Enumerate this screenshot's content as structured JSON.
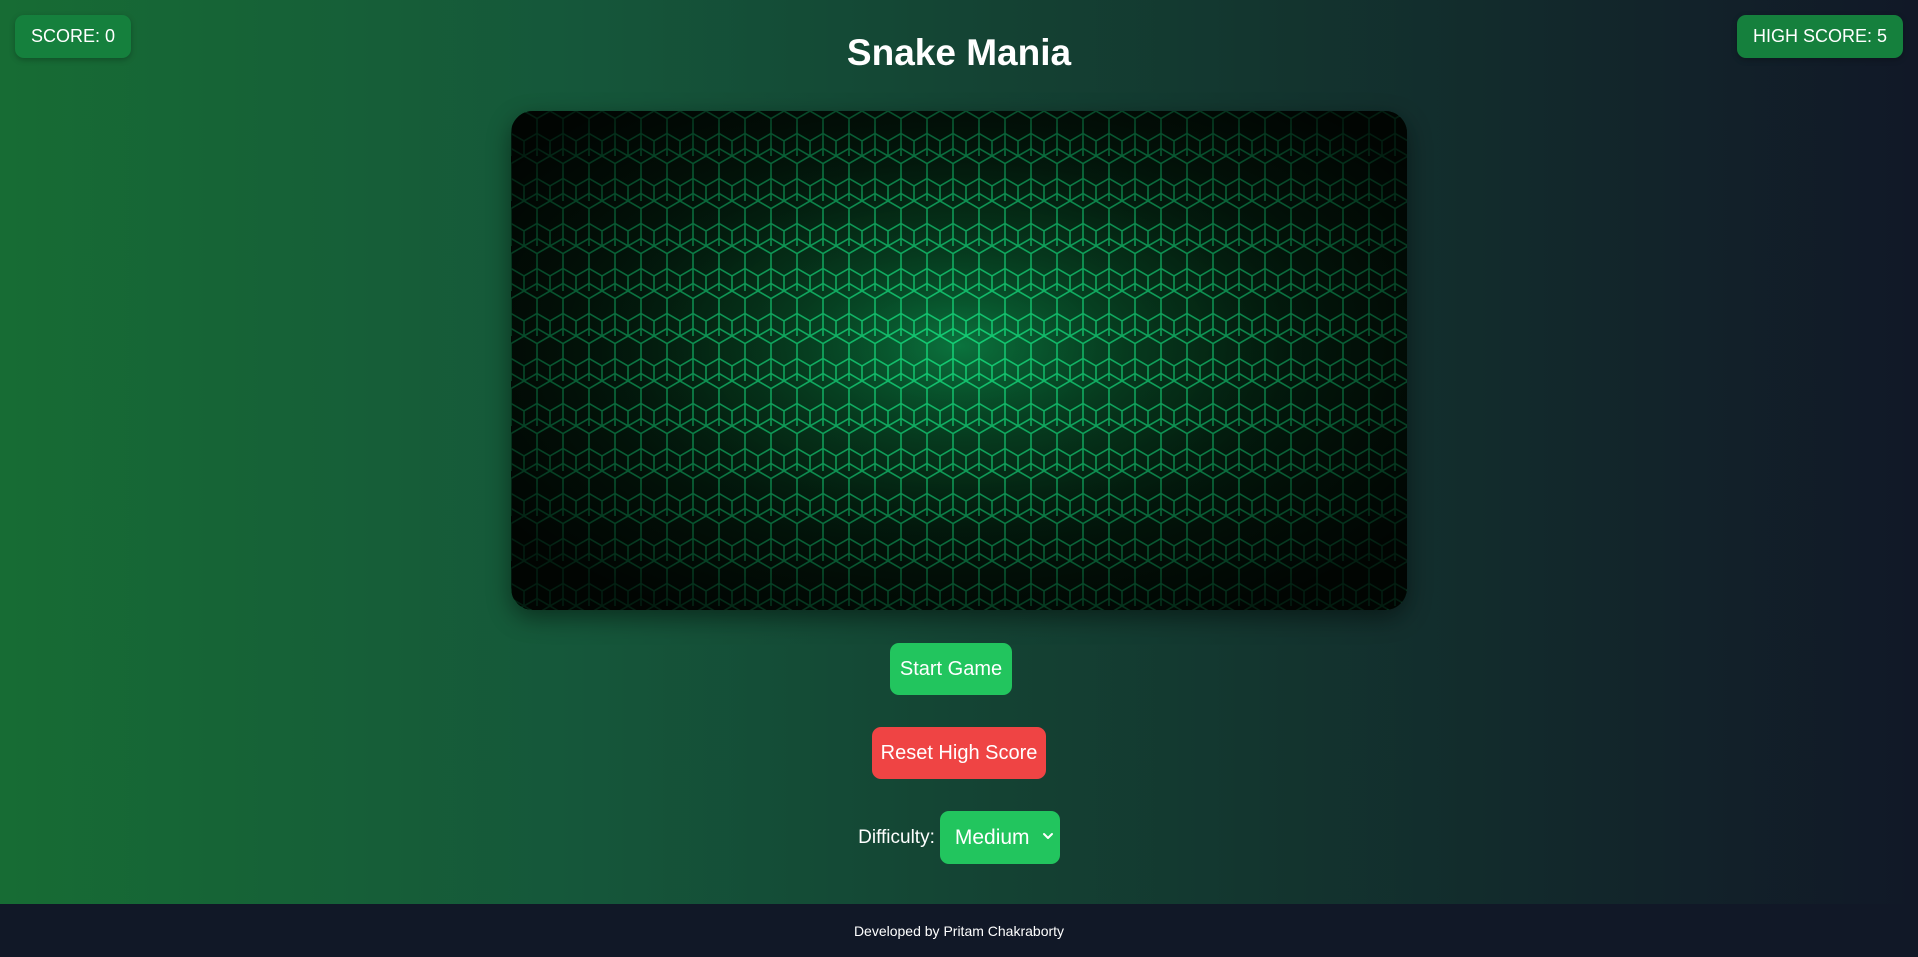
{
  "header": {
    "score_text": "SCORE: 0",
    "high_score_text": "HIGH SCORE: 5",
    "title": "Snake Mania"
  },
  "game": {
    "score": 0,
    "high_score": 5,
    "board_pattern": "hexagon-grid",
    "board_glow_color": "#18d67a"
  },
  "controls": {
    "start_label": "Start Game",
    "reset_label": "Reset High Score",
    "difficulty_label": "Difficulty:",
    "difficulty_selected": "Medium",
    "difficulty_icon": "chevron-down-icon"
  },
  "footer": {
    "credit": "Developed by Pritam Chakraborty"
  },
  "colors": {
    "badge": "#15803d",
    "start_button": "#22c55e",
    "reset_button": "#ef4444",
    "select": "#22c55e",
    "footer_bg": "#111827"
  }
}
